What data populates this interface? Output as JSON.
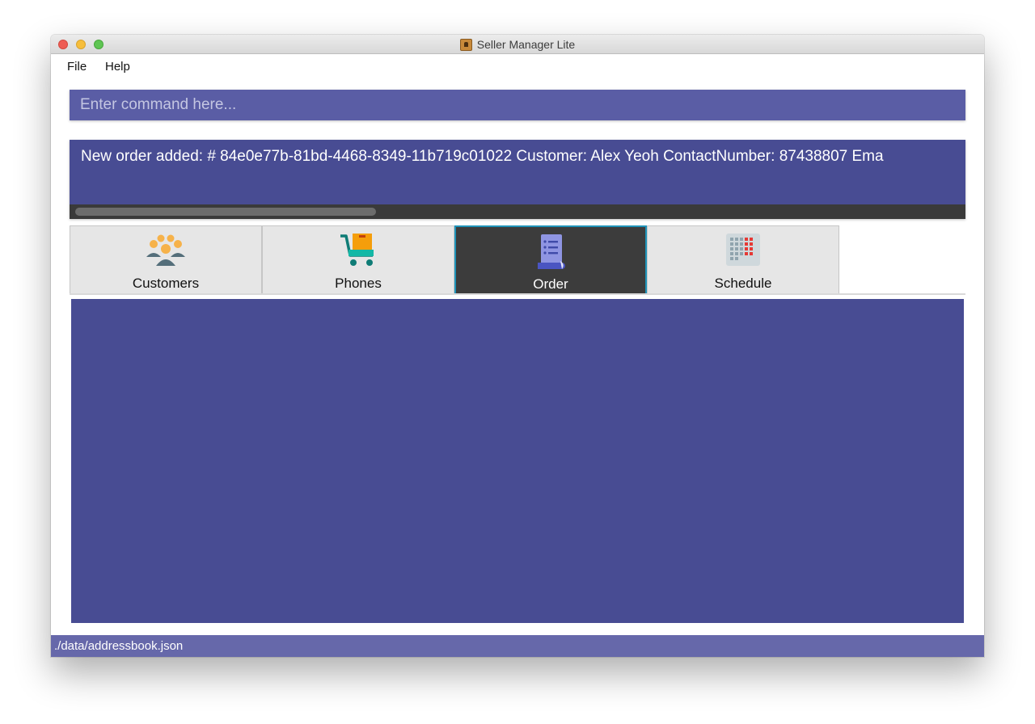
{
  "window": {
    "title": "Seller Manager Lite"
  },
  "menu": {
    "file": "File",
    "help": "Help"
  },
  "command": {
    "placeholder": "Enter command here...",
    "value": ""
  },
  "result": {
    "text": "New order added:  # 84e0e77b-81bd-4468-8349-11b719c01022 Customer: Alex Yeoh ContactNumber: 87438807 Ema"
  },
  "tabs": [
    {
      "label": "Customers",
      "icon": "customers-icon",
      "active": false
    },
    {
      "label": "Phones",
      "icon": "shopping-cart-icon",
      "active": false
    },
    {
      "label": "Order",
      "icon": "order-receipt-icon",
      "active": true
    },
    {
      "label": "Schedule",
      "icon": "calendar-icon",
      "active": false
    }
  ],
  "status": {
    "path": "./data/addressbook.json"
  },
  "colors": {
    "command_bg": "#5a5da5",
    "result_bg": "#484c93",
    "list_bg": "#484c93",
    "status_bg": "#6668aa",
    "active_tab_bg": "#3c3c3c",
    "active_tab_border": "#1f93b8"
  }
}
